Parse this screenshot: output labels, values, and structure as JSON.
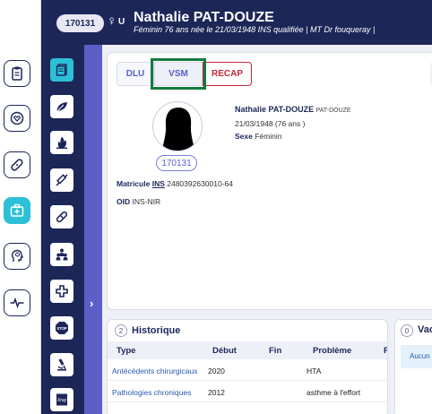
{
  "patient": {
    "id": "170131",
    "sex_letter": "U",
    "name": "Nathalie PAT-DOUZE",
    "subtitle": "Féminin 76 ans née le 21/03/1948 INS qualifiée | MT Dr fouqueray |"
  },
  "tabs": {
    "dlu": "DLU",
    "vsm": "VSM",
    "recap": "RECAP"
  },
  "card": {
    "avatar_id": "170131",
    "name_bold": "Nathalie PAT-DOUZE",
    "name_small": "PAT-DOUZE",
    "birth": "21/03/1948 (76 ans )",
    "sex_label": "Sexe",
    "sex_value": "Féminin",
    "matricule_label": "Matricule",
    "matricule_ins": "INS",
    "matricule_value": "2480392630010-64",
    "oid_label": "OID",
    "oid_value": "INS-NIR"
  },
  "historique": {
    "number": "2",
    "title": "Historique",
    "columns": [
      "Type",
      "Début",
      "Fin",
      "Problème",
      "F"
    ],
    "rows": [
      {
        "type": "Antécédents chirurgicaux",
        "debut": "2020",
        "fin": "",
        "probleme": "HTA"
      },
      {
        "type": "Pathologies chroniques",
        "debut": "2012",
        "fin": "",
        "probleme": "asthme à l'effort"
      }
    ]
  },
  "vaccination": {
    "number": "0",
    "title": "Vac",
    "note": "Aucun"
  },
  "colors": {
    "navy": "#1c2758",
    "accent": "#2cc0d6",
    "purple": "#5b5fc7",
    "recap_red": "#c4293a",
    "highlight_green": "#127a3e"
  }
}
